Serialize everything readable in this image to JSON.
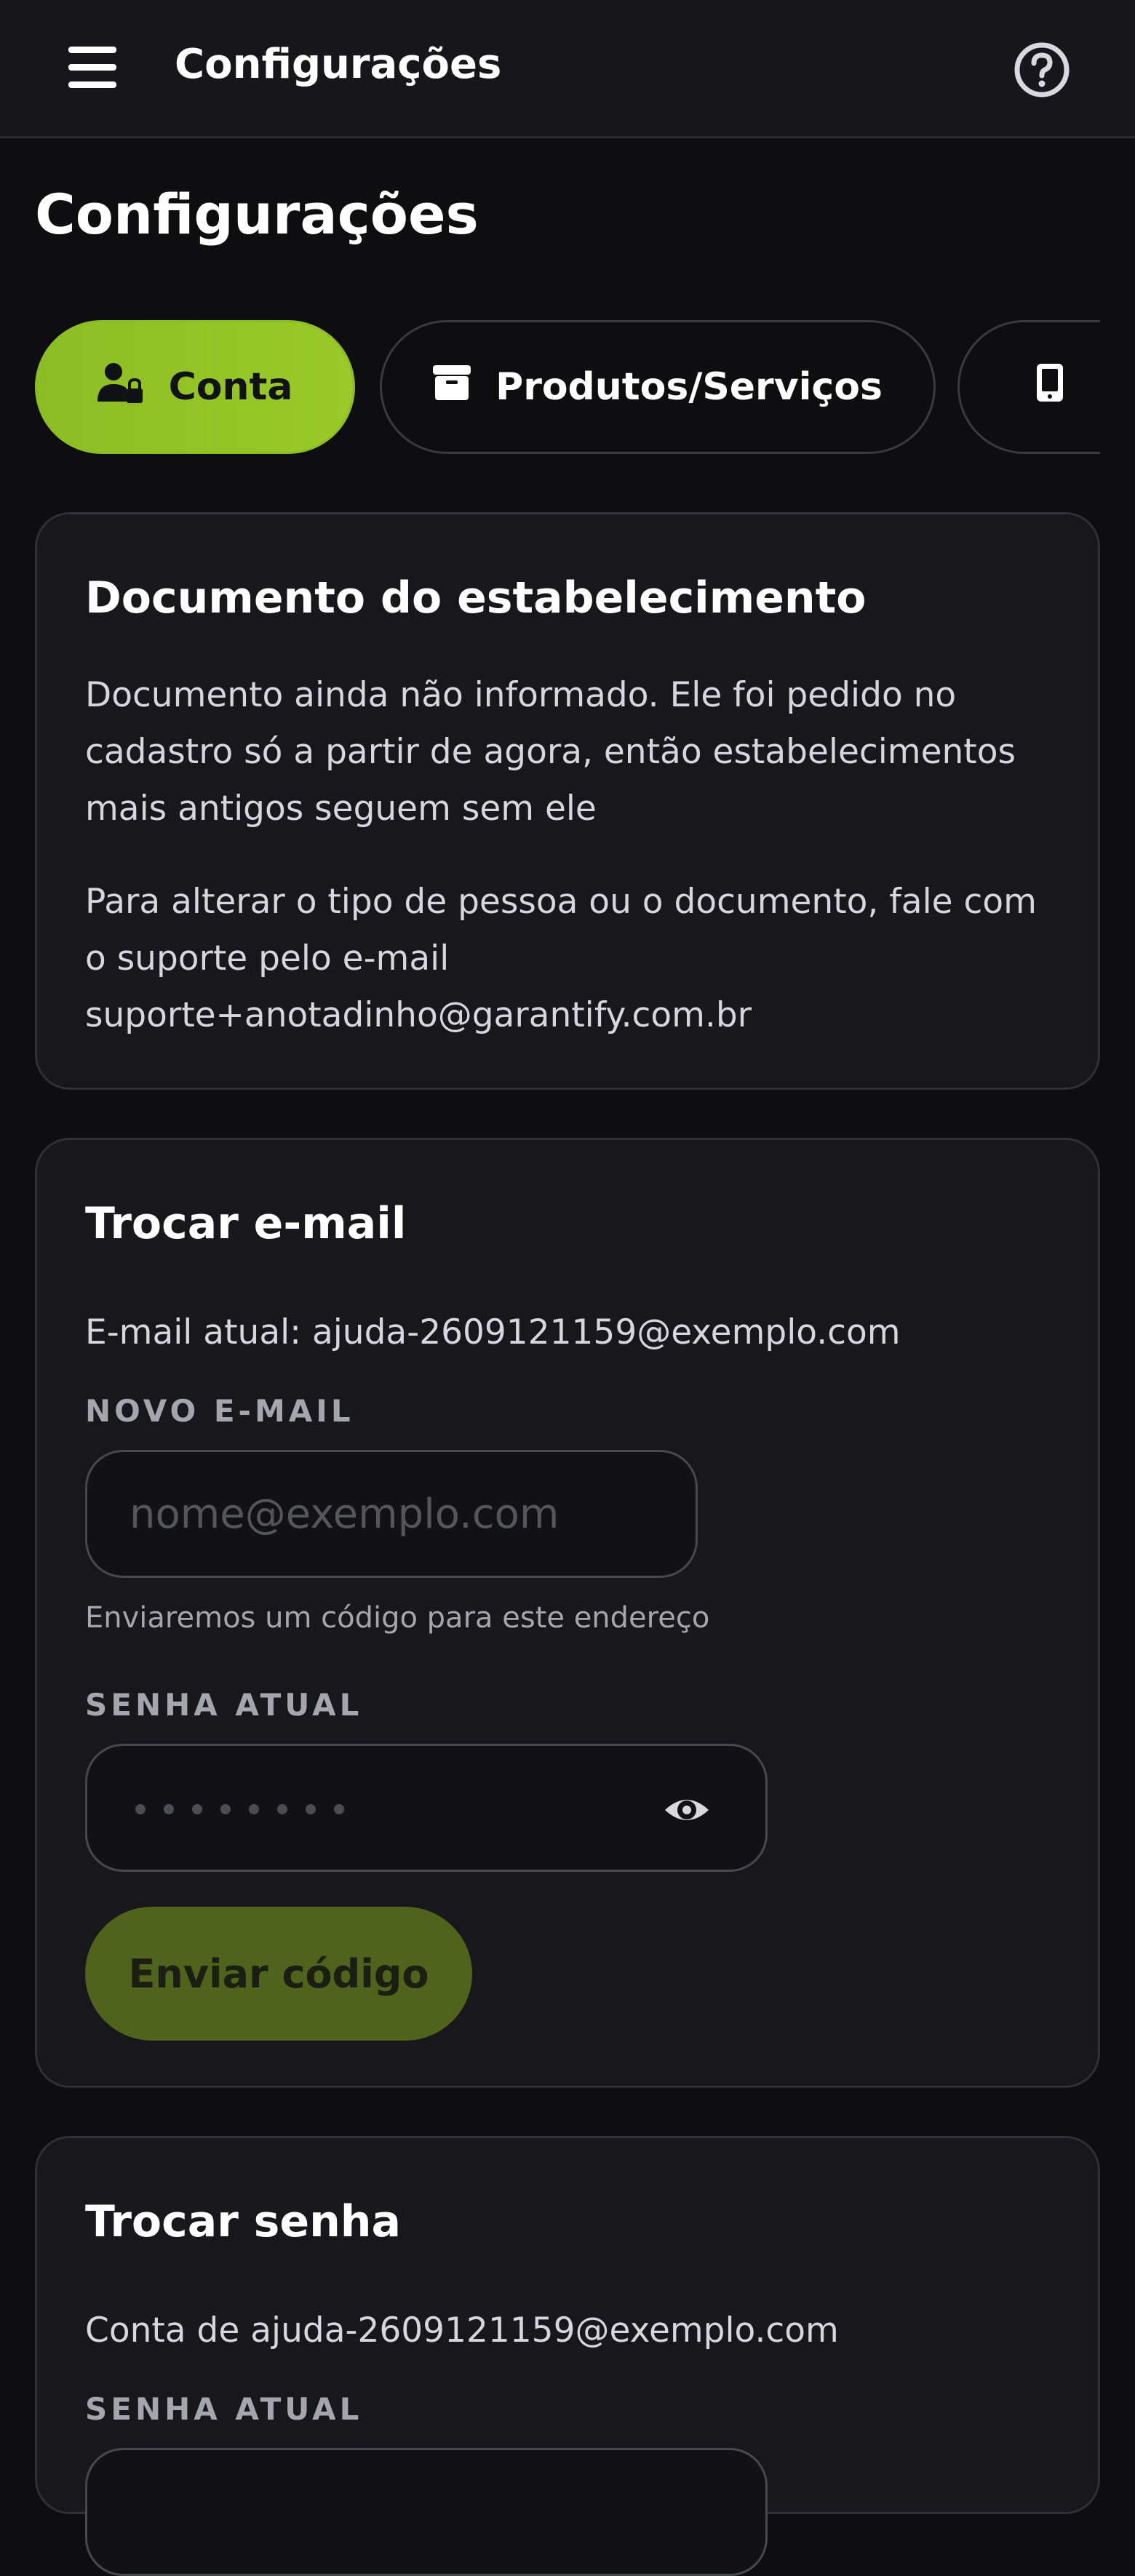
{
  "header": {
    "title": "Configurações",
    "menu_icon": "menu-icon",
    "help_icon": "help-icon"
  },
  "page": {
    "title": "Configurações"
  },
  "tabs": [
    {
      "label": "Conta",
      "icon": "user-lock-icon",
      "active": true
    },
    {
      "label": "Produtos/Serviços",
      "icon": "box-icon",
      "active": false
    },
    {
      "label": "",
      "icon": "smartphone-icon",
      "active": false
    }
  ],
  "document_card": {
    "title": "Documento do estabelecimento",
    "text1": "Documento ainda não informado. Ele foi pedido no cadastro só a partir de agora, então estabelecimentos mais antigos seguem sem ele",
    "text2": "Para alterar o tipo de pessoa ou o documento, fale com o suporte pelo e-mail suporte+anotadinho@garantify.com.br"
  },
  "email_card": {
    "title": "Trocar e-mail",
    "current_email": "E-mail atual: ajuda-2609121159@exemplo.com",
    "new_email_label": "NOVO E-MAIL",
    "new_email_value": "",
    "new_email_placeholder": "nome@exemplo.com",
    "new_email_helper": "Enviaremos um código para este endereço",
    "password_label": "SENHA ATUAL",
    "send_button": "Enviar código"
  },
  "password_card": {
    "title": "Trocar senha",
    "account_text": "Conta de ajuda-2609121159@exemplo.com",
    "password_label": "SENHA ATUAL"
  },
  "colors": {
    "accent": "#8dbd25",
    "accent_disabled": "#4f631c",
    "background": "#0e0e11",
    "card": "#18181c"
  }
}
